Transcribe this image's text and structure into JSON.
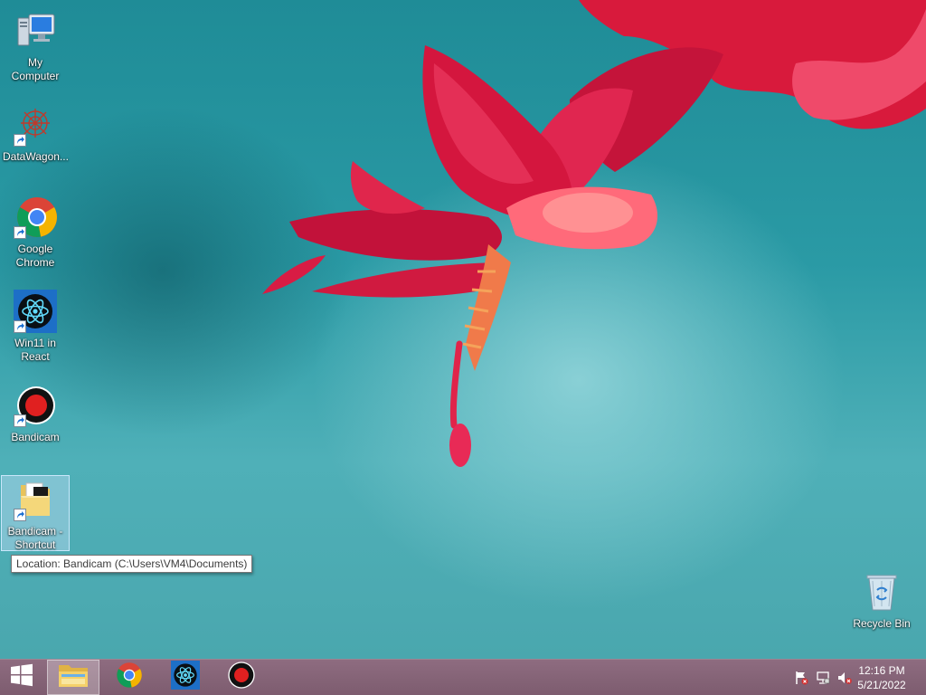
{
  "desktop": {
    "icons": [
      {
        "name": "my-computer",
        "label": "My Computer"
      },
      {
        "name": "datawagon",
        "label": "DataWagon..."
      },
      {
        "name": "google-chrome",
        "label": "Google Chrome"
      },
      {
        "name": "win11-in-react",
        "label": "Win11 in React"
      },
      {
        "name": "bandicam",
        "label": "Bandicam"
      },
      {
        "name": "bandicam-shortcut",
        "label": "Bandicam - Shortcut"
      }
    ],
    "recycle_bin": {
      "label": "Recycle Bin"
    }
  },
  "tooltip": {
    "text": "Location: Bandicam (C:\\Users\\VM4\\Documents)"
  },
  "taskbar": {
    "start_icon": "windows-logo-icon",
    "pinned": [
      {
        "name": "file-explorer",
        "icon": "folder-icon",
        "active": true
      },
      {
        "name": "google-chrome",
        "icon": "chrome-icon",
        "active": false
      },
      {
        "name": "win11-in-react",
        "icon": "react-icon",
        "active": false
      },
      {
        "name": "bandicam",
        "icon": "record-icon",
        "active": false
      }
    ],
    "tray": {
      "icons": [
        "action-center-flag-icon",
        "network-icon",
        "volume-muted-icon"
      ],
      "time": "12:16 PM",
      "date": "5/21/2022"
    }
  },
  "colors": {
    "wallpaper_teal": "#2a9aa5",
    "flower_red": "#e8264f",
    "taskbar": "#846376",
    "bandicam_red": "#e02020"
  }
}
